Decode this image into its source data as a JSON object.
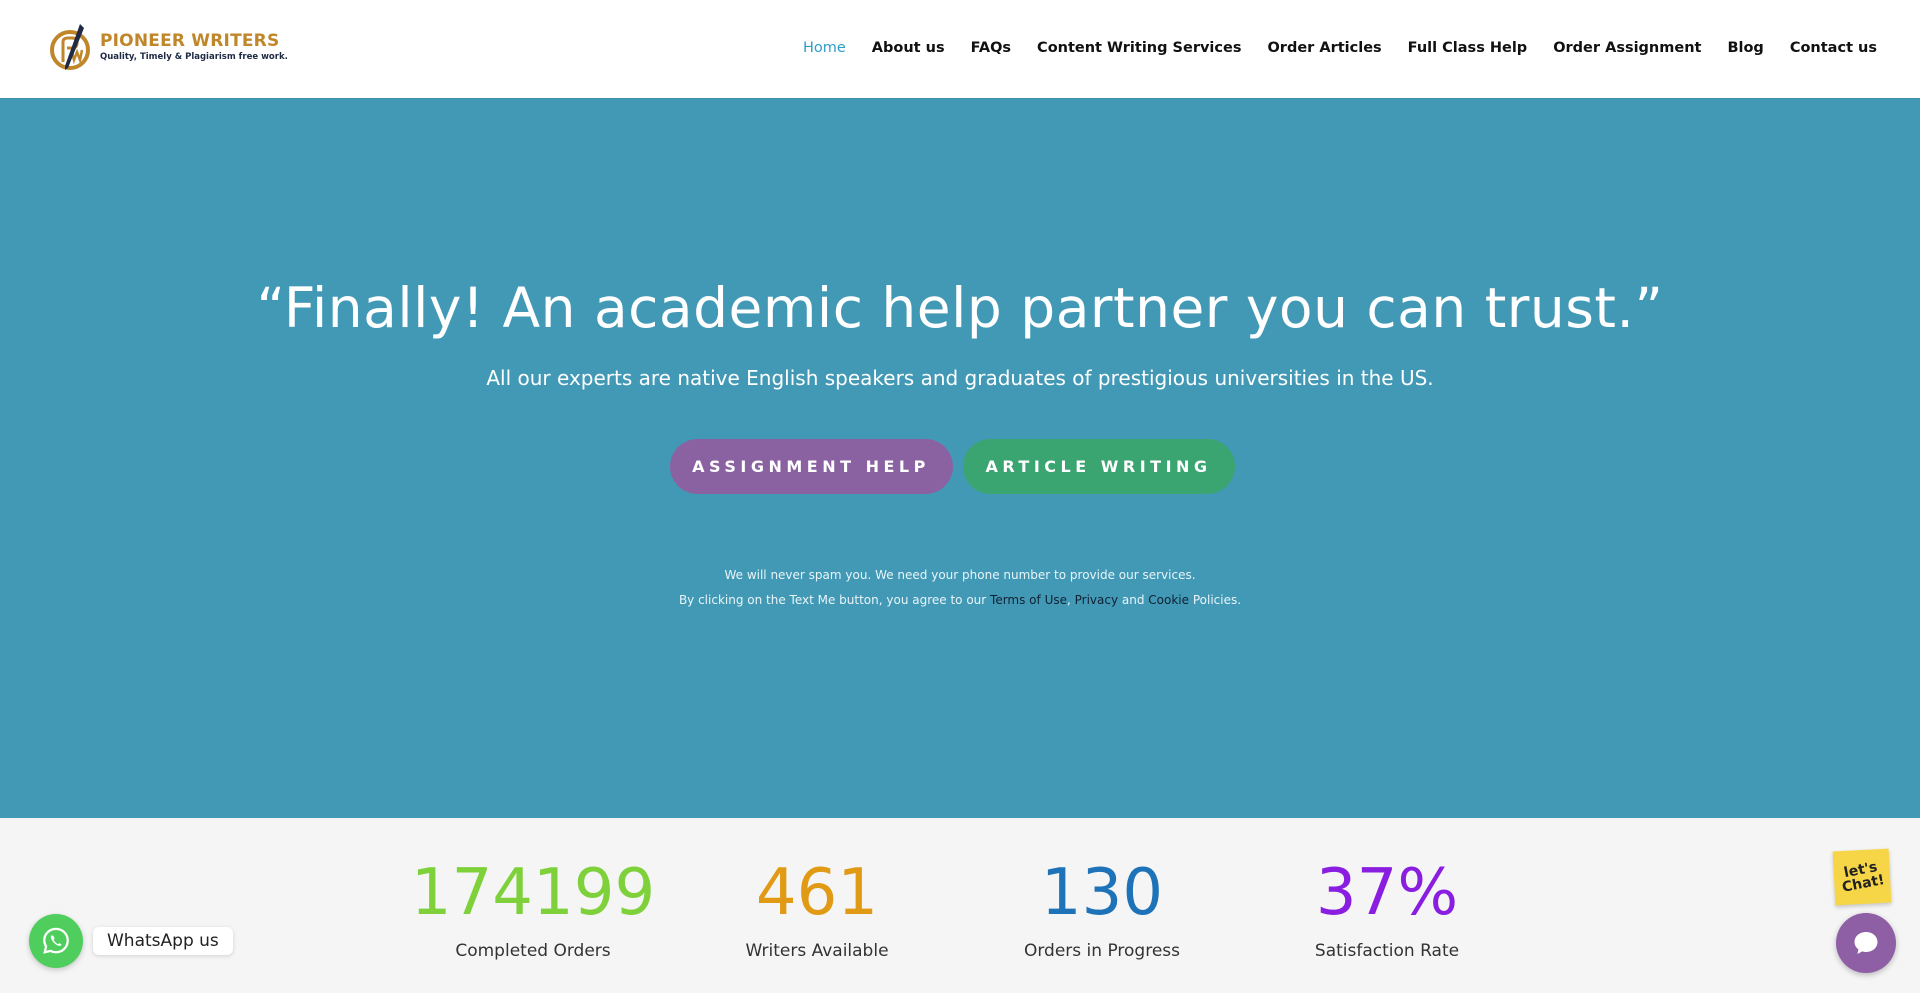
{
  "logo": {
    "name": "PIONEER WRITERS",
    "tagline": "Quality, Timely & Plagiarism free work."
  },
  "nav": {
    "items": [
      {
        "label": "Home",
        "active": true
      },
      {
        "label": "About us"
      },
      {
        "label": "FAQs"
      },
      {
        "label": "Content Writing Services"
      },
      {
        "label": "Order Articles"
      },
      {
        "label": "Full Class Help"
      },
      {
        "label": "Order Assignment"
      },
      {
        "label": "Blog"
      },
      {
        "label": "Contact us"
      }
    ]
  },
  "hero": {
    "title": "“Finally! An academic help partner you can trust.”",
    "subtitle": "All our experts are native English speakers and graduates of prestigious universities in the US.",
    "btn_assignment": "ASSIGNMENT HELP",
    "btn_article": "ARTICLE WRITING",
    "note_line1": "We will never spam you. We need your phone number to provide our services.",
    "note_line2_prefix": "By clicking on the Text Me button, you agree to our ",
    "note_terms": "Terms of Use",
    "note_comma": ", ",
    "note_privacy": "Privacy",
    "note_and": " and ",
    "note_cookie": "Cookie",
    "note_suffix": " Policies."
  },
  "stats": [
    {
      "value": "174199",
      "label": "Completed Orders",
      "color": "#7fd13b"
    },
    {
      "value": "461",
      "label": "Writers Available",
      "color": "#e19a14"
    },
    {
      "value": "130",
      "label": "Orders in Progress",
      "color": "#1d72b8"
    },
    {
      "value": "37%",
      "label": "Satisfaction Rate",
      "color": "#8a1ee0"
    }
  ],
  "whatsapp": {
    "label": "WhatsApp us"
  },
  "chat": {
    "note": "let's Chat!"
  },
  "colors": {
    "hero_bg": "#4299b6",
    "nav_active": "#2e9dc8",
    "btn_purple": "#8b62a1",
    "btn_green": "#3aa571"
  }
}
